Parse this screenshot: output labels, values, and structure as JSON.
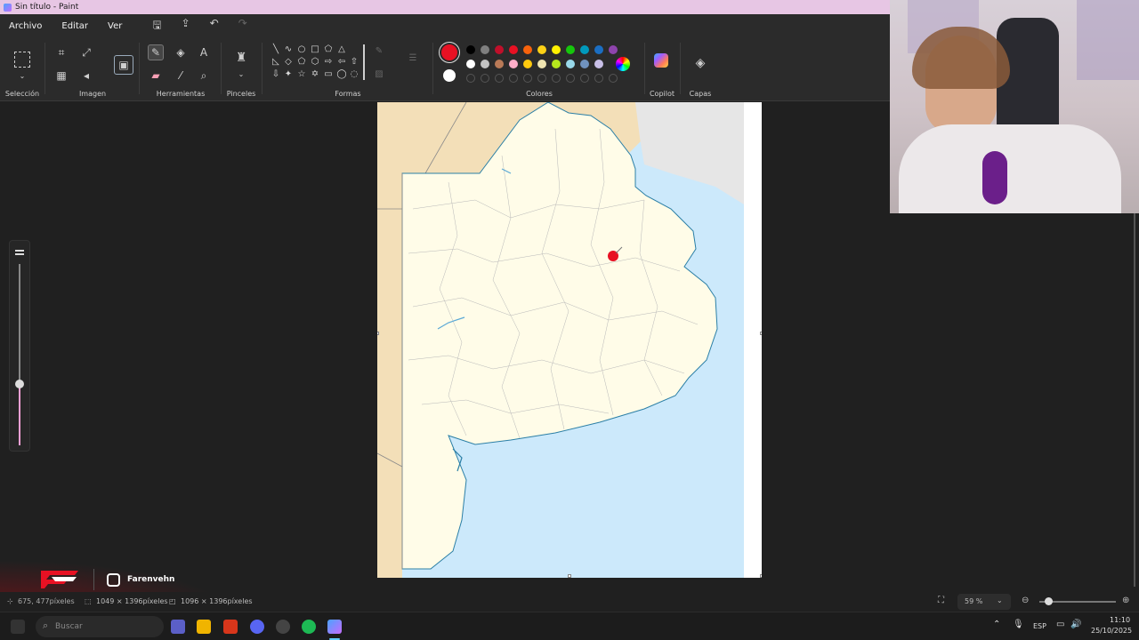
{
  "window": {
    "title": "Sin título - Paint"
  },
  "menu": {
    "file": "Archivo",
    "edit": "Editar",
    "view": "Ver"
  },
  "ribbon": {
    "groups": {
      "selection": "Selección",
      "image": "Imagen",
      "tools": "Herramientas",
      "brushes": "Pinceles",
      "shapes": "Formas",
      "colors": "Colores",
      "copilot": "Copilot",
      "layers": "Capas"
    },
    "selected_color_primary": "#e81123",
    "selected_color_secondary": "#ffffff",
    "palette_row1": [
      "#000000",
      "#7f7f7f",
      "#c00f2a",
      "#e81123",
      "#f7630c",
      "#fcd116",
      "#fff100",
      "#16c60c",
      "#0099bc",
      "#1b6ec2",
      "#8e44ad"
    ],
    "palette_row2": [
      "#ffffff",
      "#c3c3c3",
      "#b97a57",
      "#ffaec9",
      "#ffc90e",
      "#efe4b0",
      "#b5e61d",
      "#99d9ea",
      "#7092be",
      "#c8bfe7"
    ]
  },
  "status": {
    "cursor_pos": "675, 477píxeles",
    "selection_size": "1049 × 1396píxeles",
    "canvas_size": "1096 × 1396píxeles",
    "zoom": "59 %"
  },
  "stream_overlay": {
    "handle": "Farenvehn"
  },
  "taskbar": {
    "search_placeholder": "Buscar",
    "language": "ESP",
    "time": "11:10",
    "date": "25/10/2025"
  }
}
